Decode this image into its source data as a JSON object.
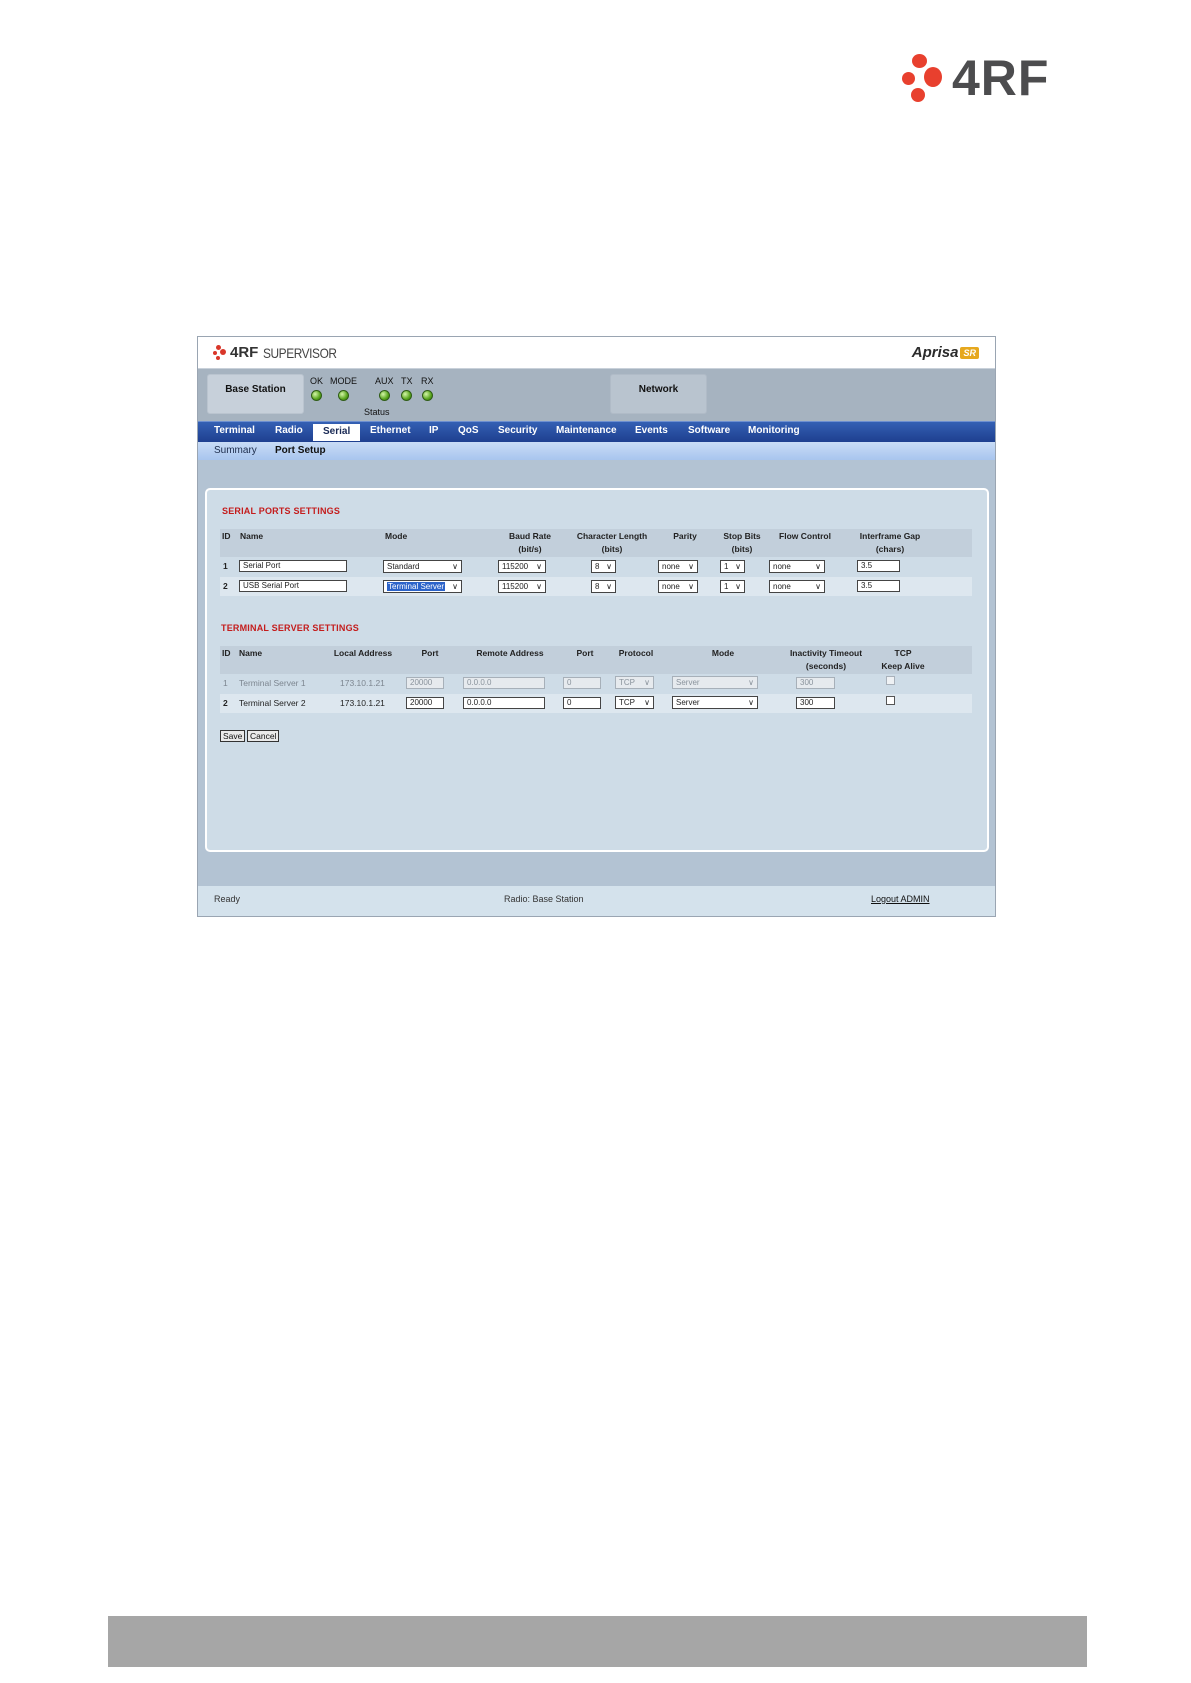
{
  "page": {
    "logo_text": "4RF"
  },
  "app": {
    "logo_brand": "4RF",
    "logo_product": "SUPERVISOR",
    "product_name": "Aprisa",
    "product_badge": "SR"
  },
  "header": {
    "station": "Base Station",
    "network": "Network",
    "status_label": "Status",
    "leds": [
      {
        "label": "OK",
        "color": "#5cab22"
      },
      {
        "label": "MODE",
        "color": "#5cab22"
      },
      {
        "label": "AUX",
        "color": "#5cab22"
      },
      {
        "label": "TX",
        "color": "#5cab22"
      },
      {
        "label": "RX",
        "color": "#5cab22"
      }
    ]
  },
  "nav": {
    "tabs": [
      "Terminal",
      "Radio",
      "Serial",
      "Ethernet",
      "IP",
      "QoS",
      "Security",
      "Maintenance",
      "Events",
      "Software",
      "Monitoring"
    ],
    "active": "Serial"
  },
  "subnav": {
    "items": [
      "Summary",
      "Port Setup"
    ],
    "active": "Port Setup"
  },
  "serial": {
    "title": "SERIAL PORTS SETTINGS",
    "headers": {
      "id": "ID",
      "name": "Name",
      "mode": "Mode",
      "baud1": "Baud Rate",
      "baud2": "(bit/s)",
      "char1": "Character Length",
      "char2": "(bits)",
      "parity": "Parity",
      "stop1": "Stop Bits",
      "stop2": "(bits)",
      "flow": "Flow Control",
      "gap1": "Interframe Gap",
      "gap2": "(chars)"
    },
    "rows": [
      {
        "id": "1",
        "name": "Serial Port",
        "mode": "Standard",
        "baud": "115200",
        "char_length": "8",
        "parity": "none",
        "stop_bits": "1",
        "flow": "none",
        "gap": "3.5"
      },
      {
        "id": "2",
        "name": "USB Serial Port",
        "mode": "Terminal Server",
        "baud": "115200",
        "char_length": "8",
        "parity": "none",
        "stop_bits": "1",
        "flow": "none",
        "gap": "3.5"
      }
    ]
  },
  "terminal": {
    "title": "TERMINAL SERVER SETTINGS",
    "headers": {
      "id": "ID",
      "name": "Name",
      "local": "Local Address",
      "port": "Port",
      "remote": "Remote Address",
      "rport": "Port",
      "protocol": "Protocol",
      "mode": "Mode",
      "timeout1": "Inactivity Timeout",
      "timeout2": "(seconds)",
      "tcp1": "TCP",
      "tcp2": "Keep Alive"
    },
    "rows": [
      {
        "id": "1",
        "name": "Terminal Server 1",
        "local": "173.10.1.21",
        "port": "20000",
        "remote": "0.0.0.0",
        "rport": "0",
        "protocol": "TCP",
        "mode": "Server",
        "timeout": "300",
        "keep_alive": false,
        "disabled": true
      },
      {
        "id": "2",
        "name": "Terminal Server 2",
        "local": "173.10.1.21",
        "port": "20000",
        "remote": "0.0.0.0",
        "rport": "0",
        "protocol": "TCP",
        "mode": "Server",
        "timeout": "300",
        "keep_alive": false,
        "disabled": false
      }
    ]
  },
  "buttons": {
    "save": "Save",
    "cancel": "Cancel"
  },
  "footer": {
    "status": "Ready",
    "radio": "Radio: Base Station",
    "logout": "Logout ADMIN"
  }
}
